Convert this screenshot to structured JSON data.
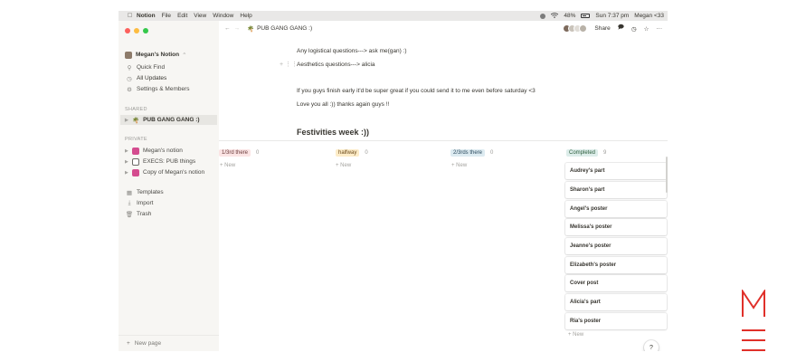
{
  "menubar": {
    "app": "Notion",
    "items": [
      "File",
      "Edit",
      "View",
      "Window",
      "Help"
    ],
    "battery": "48%",
    "clock": "Sun 7:37 pm",
    "user": "Megan <33"
  },
  "sidebar": {
    "workspace": "Megan's Notion",
    "workspace_chevron": "⌃",
    "quick_find": "Quick Find",
    "all_updates": "All Updates",
    "settings": "Settings & Members",
    "shared_label": "SHARED",
    "shared_pages": [
      {
        "label": "PUB GANG GANG :)",
        "icon": "palm-tree-icon"
      }
    ],
    "private_label": "PRIVATE",
    "private_pages": [
      {
        "label": "Megan's notion",
        "icon": "page-icon"
      },
      {
        "label": "EXECS: PUB things",
        "icon": "checkbox-icon"
      },
      {
        "label": "Copy of Megan's notion",
        "icon": "page-icon"
      }
    ],
    "templates": "Templates",
    "import": "Import",
    "trash": "Trash",
    "new_page": "New page"
  },
  "topbar": {
    "breadcrumb": "PUB GANG GANG :)",
    "share": "Share"
  },
  "content": {
    "line1": "Any logistical questions---> ask me(gan) :)",
    "line2": "Aesthetics questions---> alicia",
    "line3": "If you guys finish early it'd be super great if you could send it to me even before saturday <3",
    "line4": "Love you all :)) thanks again guys !!",
    "heading": "Festivities week :))"
  },
  "board": {
    "columns": [
      {
        "label": "1/3rd there",
        "count": "0",
        "bg": "#fbe4e4",
        "fg": "#6b3b3b"
      },
      {
        "label": "halfway",
        "count": "0",
        "bg": "#fdecc8",
        "fg": "#6b4a1b"
      },
      {
        "label": "2/3rds there",
        "count": "0",
        "bg": "#ddebf1",
        "fg": "#2b4a5e"
      },
      {
        "label": "Completed",
        "count": "9",
        "bg": "#ddedea",
        "fg": "#2a5c3a"
      }
    ],
    "new_label": "+ New",
    "cards": [
      "Audrey's part",
      "Sharon's part",
      "Angel's poster",
      "Melissa's poster",
      "Jeanne's poster",
      "Elizabeth's poster",
      "Cover post",
      "Alicia's part",
      "Ria's poster"
    ]
  },
  "help": "?",
  "colors": {
    "sidebar_bg": "#f7f6f3",
    "logo_red": "#e0302a"
  }
}
